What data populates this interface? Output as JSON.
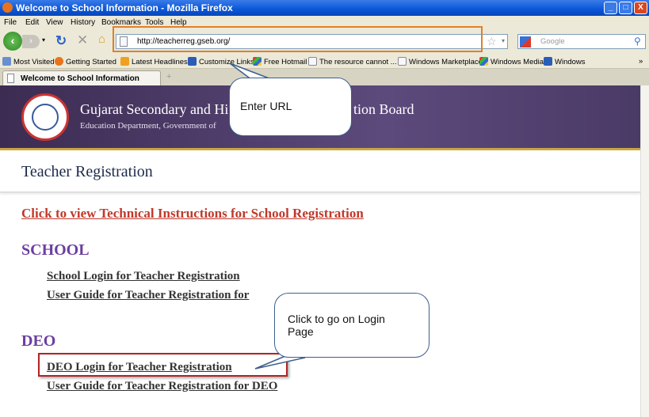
{
  "window": {
    "title": "Welcome to School Information - Mozilla Firefox",
    "minimize": "_",
    "maximize": "□",
    "close": "X"
  },
  "menu": [
    "File",
    "Edit",
    "View",
    "History",
    "Bookmarks",
    "Tools",
    "Help"
  ],
  "address": {
    "url": "http://teacherreg.gseb.org/"
  },
  "search": {
    "placeholder": "Google"
  },
  "bookmarks": [
    "Most Visited",
    "Getting Started",
    "Latest Headlines",
    "Customize Links",
    "Free Hotmail",
    "The resource cannot ...",
    "Windows Marketplace",
    "Windows Media",
    "Windows"
  ],
  "bookmarks_more": "»",
  "tab": {
    "label": "Welcome to School Information",
    "new_tab": "+"
  },
  "header": {
    "title_left": "Gujarat Secondary and Hig",
    "title_right": "tion Board",
    "subtitle": "Education Department, Government of"
  },
  "page": {
    "heading": "Teacher Registration",
    "instructions_link": "Click to view Technical Instructions for School Registration",
    "school": {
      "heading": "SCHOOL",
      "login": "School Login for Teacher Registration",
      "guide": "User Guide for Teacher Registration  for"
    },
    "deo": {
      "heading": "DEO",
      "login": "DEO Login for Teacher Registration",
      "guide": "User Guide for Teacher Registration  for DEO"
    }
  },
  "callouts": {
    "url": "Enter URL",
    "login": "Click to go on Login Page"
  },
  "colors": {
    "accent_purple": "#6b3fa0",
    "link_red": "#c0392b",
    "highlight_orange": "#e0802a",
    "highlight_red": "#b22222"
  }
}
